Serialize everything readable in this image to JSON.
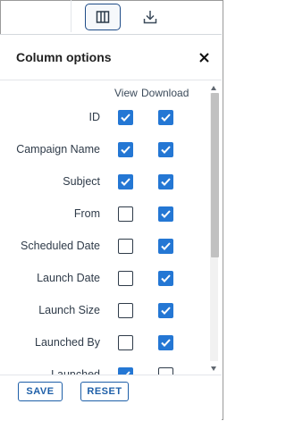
{
  "toolbar": {
    "columns_icon": "columns-icon",
    "download_icon": "download-icon"
  },
  "panel": {
    "title": "Column options",
    "close_icon": "close-icon",
    "headers": {
      "view": "View",
      "download": "Download"
    },
    "rows": [
      {
        "label": "ID",
        "view": true,
        "download": true
      },
      {
        "label": "Campaign Name",
        "view": true,
        "download": true
      },
      {
        "label": "Subject",
        "view": true,
        "download": true
      },
      {
        "label": "From",
        "view": false,
        "download": true
      },
      {
        "label": "Scheduled Date",
        "view": false,
        "download": true
      },
      {
        "label": "Launch Date",
        "view": false,
        "download": true
      },
      {
        "label": "Launch Size",
        "view": false,
        "download": true
      },
      {
        "label": "Launched By",
        "view": false,
        "download": true
      },
      {
        "label": "Launched",
        "view": true,
        "download": false
      }
    ],
    "buttons": {
      "save": "SAVE",
      "reset": "RESET"
    }
  },
  "colors": {
    "accent": "#2477d4",
    "button_border": "#1e5fa8",
    "text": "#2f3b49"
  }
}
